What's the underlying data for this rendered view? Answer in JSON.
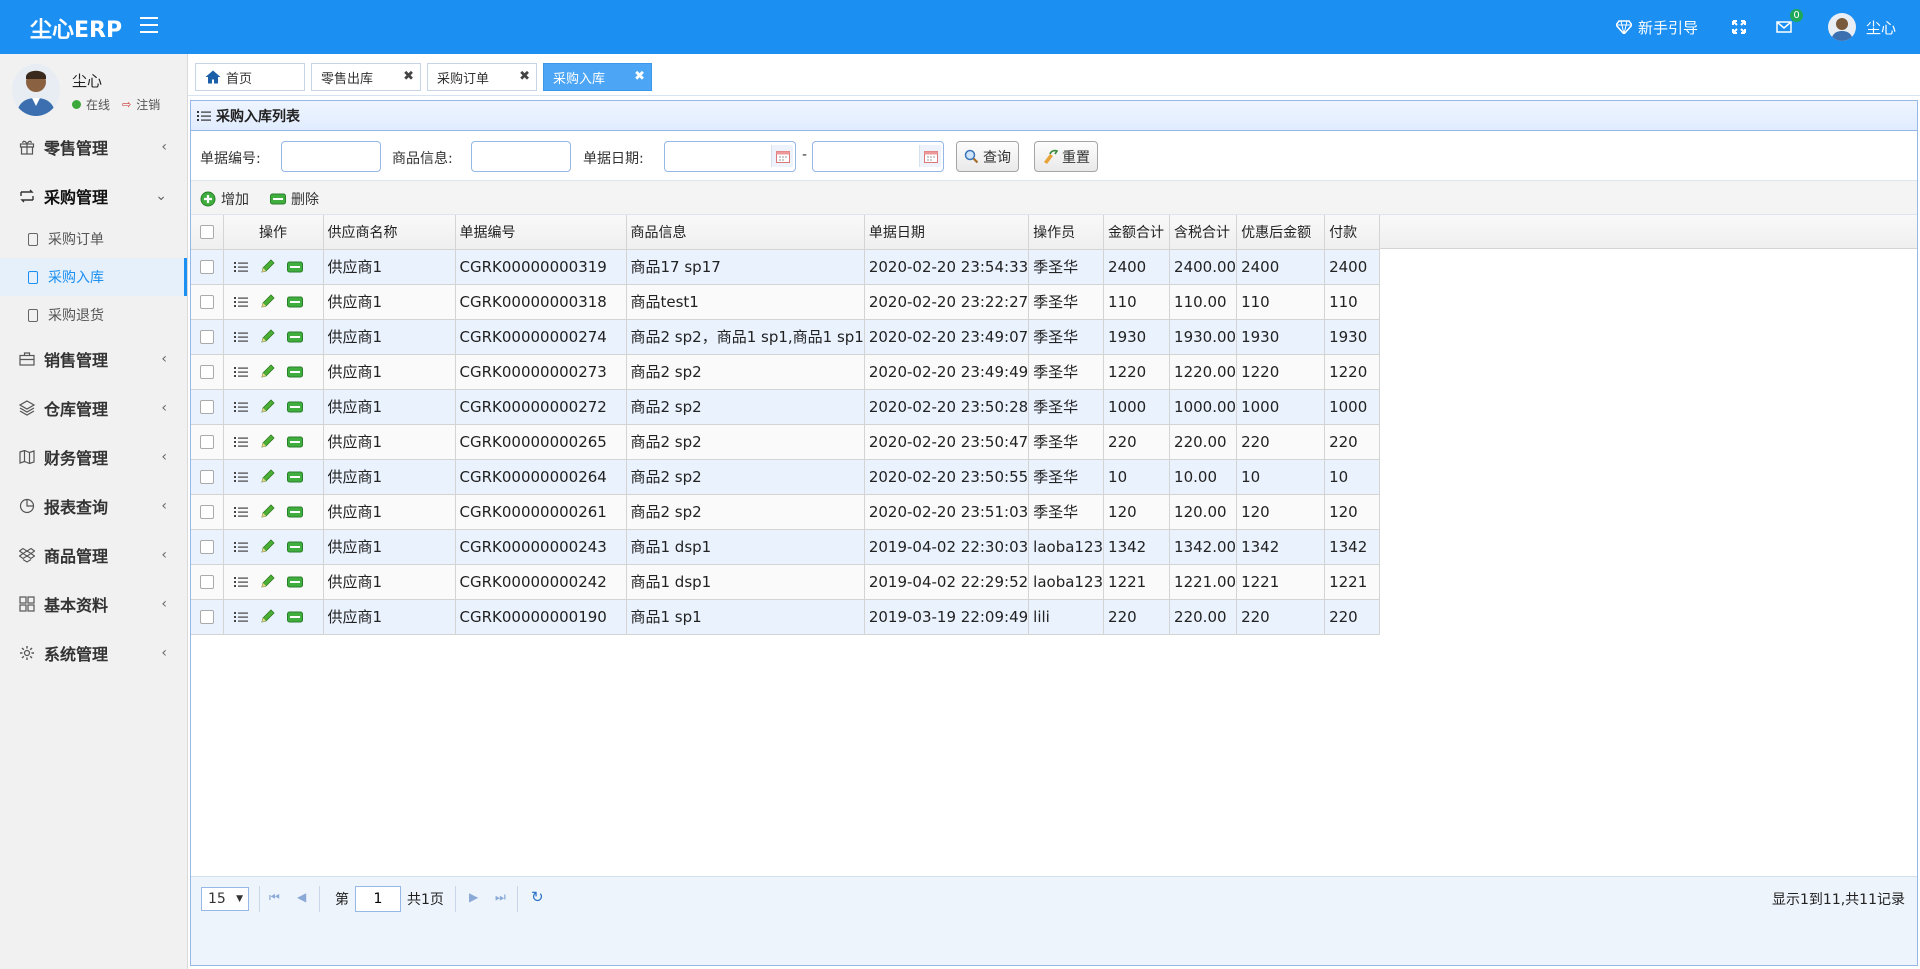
{
  "app": {
    "brand": "尘心ERP",
    "guide_label": "新手引导",
    "mail_badge": "0",
    "user_name": "尘心"
  },
  "sidebar": {
    "user": {
      "name": "尘心",
      "status": "在线",
      "logout": "注销"
    },
    "menus": [
      {
        "label": "零售管理",
        "icon": "gift-icon"
      },
      {
        "label": "采购管理",
        "icon": "exchange-icon",
        "open": true,
        "children": [
          {
            "label": "采购订单"
          },
          {
            "label": "采购入库",
            "active": true
          },
          {
            "label": "采购退货"
          }
        ]
      },
      {
        "label": "销售管理",
        "icon": "briefcase-icon"
      },
      {
        "label": "仓库管理",
        "icon": "layers-icon"
      },
      {
        "label": "财务管理",
        "icon": "map-icon"
      },
      {
        "label": "报表查询",
        "icon": "pie-chart-icon"
      },
      {
        "label": "商品管理",
        "icon": "dropbox-icon"
      },
      {
        "label": "基本资料",
        "icon": "grid-icon"
      },
      {
        "label": "系统管理",
        "icon": "gear-icon"
      }
    ]
  },
  "tabs": [
    {
      "label": "首页"
    },
    {
      "label": "零售出库"
    },
    {
      "label": "采购订单"
    },
    {
      "label": "采购入库",
      "active": true
    }
  ],
  "panel": {
    "title": "采购入库列表",
    "search": {
      "bill_no_label": "单据编号:",
      "bill_no_value": "",
      "product_label": "商品信息:",
      "product_value": "",
      "date_label": "单据日期:",
      "date_from": "",
      "date_sep": "-",
      "date_to": "",
      "query_label": "查询",
      "reset_label": "重置"
    },
    "toolbar": {
      "add_label": "增加",
      "delete_label": "删除"
    }
  },
  "table": {
    "columns": [
      "操作",
      "供应商名称",
      "单据编号",
      "商品信息",
      "单据日期",
      "操作员",
      "金额合计",
      "含税合计",
      "优惠后金额",
      "付款"
    ],
    "rows": [
      [
        "供应商1",
        "CGRK00000000319",
        "商品17 sp17",
        "2020-02-20 23:54:33",
        "季圣华",
        "2400",
        "2400.00",
        "2400",
        "2400"
      ],
      [
        "供应商1",
        "CGRK00000000318",
        "商品test1",
        "2020-02-20 23:22:27",
        "季圣华",
        "110",
        "110.00",
        "110",
        "110"
      ],
      [
        "供应商1",
        "CGRK00000000274",
        "商品2 sp2，商品1 sp1,商品1 sp1",
        "2020-02-20 23:49:07",
        "季圣华",
        "1930",
        "1930.00",
        "1930",
        "1930"
      ],
      [
        "供应商1",
        "CGRK00000000273",
        "商品2 sp2",
        "2020-02-20 23:49:49",
        "季圣华",
        "1220",
        "1220.00",
        "1220",
        "1220"
      ],
      [
        "供应商1",
        "CGRK00000000272",
        "商品2 sp2",
        "2020-02-20 23:50:28",
        "季圣华",
        "1000",
        "1000.00",
        "1000",
        "1000"
      ],
      [
        "供应商1",
        "CGRK00000000265",
        "商品2 sp2",
        "2020-02-20 23:50:47",
        "季圣华",
        "220",
        "220.00",
        "220",
        "220"
      ],
      [
        "供应商1",
        "CGRK00000000264",
        "商品2 sp2",
        "2020-02-20 23:50:55",
        "季圣华",
        "10",
        "10.00",
        "10",
        "10"
      ],
      [
        "供应商1",
        "CGRK00000000261",
        "商品2 sp2",
        "2020-02-20 23:51:03",
        "季圣华",
        "120",
        "120.00",
        "120",
        "120"
      ],
      [
        "供应商1",
        "CGRK00000000243",
        "商品1 dsp1",
        "2019-04-02 22:30:03",
        "laoba123",
        "1342",
        "1342.00",
        "1342",
        "1342"
      ],
      [
        "供应商1",
        "CGRK00000000242",
        "商品1 dsp1",
        "2019-04-02 22:29:52",
        "laoba123",
        "1221",
        "1221.00",
        "1221",
        "1221"
      ],
      [
        "供应商1",
        "CGRK00000000190",
        "商品1 sp1",
        "2019-03-19 22:09:49",
        "lili",
        "220",
        "220.00",
        "220",
        "220"
      ]
    ]
  },
  "pager": {
    "page_size": "15",
    "page_prefix": "第",
    "page_value": "1",
    "page_suffix": "共1页",
    "info": "显示1到11,共11记录"
  },
  "colors": {
    "topbar": "#1b8ff2",
    "active_tab": "#4da6f5",
    "row_alt": "#eaf2fe",
    "accent": "#1b8ff2"
  }
}
